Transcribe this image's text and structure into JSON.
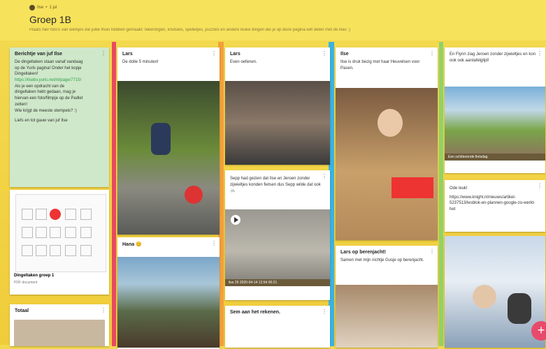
{
  "header": {
    "author": "Ilse",
    "breadcrumb_sep": "•",
    "time": "1 jul",
    "title": "Groep 1B",
    "subtitle": "Plaats hier foto's van werkjes die jullie thuis hebben gemaakt: tekeningen, knutsels, spelletjes, puzzels en andere leuke dingen die je op deze pagina wilt delen met de klas :)"
  },
  "cards": {
    "c1": {
      "title": "Berichtje van juf Ilse",
      "lines": [
        "De dingeltaken staan vanaf vandaag",
        "op de Yurls pagina! Onder het kopje",
        "Dingeltaken!",
        "https://ilsebv.yurls.net/nl/page/7715/",
        "Als je een opdracht van de",
        "dingeltaken hebt gedaan, mag je",
        "hiervan een foto/filmpje op de Padlet",
        "zetten!",
        "Wie krijgt de meeste stempels? :)",
        "",
        "Liefs en tot gauw van juf Ilse"
      ],
      "doc_title": "Dingeltaken groep 1",
      "doc_type": "PDF document"
    },
    "c2": {
      "title": "Lars",
      "text": "De dolle 5 minuten!"
    },
    "c3": {
      "title": "Hana",
      "emoji": "😊"
    },
    "c4": {
      "title": "Lars",
      "text": "Even oefenen."
    },
    "c5": {
      "text": "Sepp had gezien dat Ilse en Jeroen zonder zijwieltjes konden fietsen dus Sepp wilde dat ook 🚲",
      "video_caption": "ilse 29 2020-04-14 12:54",
      "video_duration": "00:21"
    },
    "c6": {
      "title": "Sem aan het rekenen."
    },
    "c7": {
      "title": "Ilse",
      "text": "Ilse is druk bezig met haar Heuvelsen voor Pasen."
    },
    "c8": {
      "title": "Lars op berenjacht!",
      "text": "Samen met mijn nichtje Gusje op berenjacht."
    },
    "c9": {
      "text": "En Flynn ziag Jeroen zonder zijwieltjes en kon ook ook aantafelglijd!",
      "img_caption": "Een schitterende fietsdag"
    },
    "c10": {
      "text": "Ode leuk!",
      "link": "https://www.knight.nl/nieuws/artikel-5237513/lesblok-en-plannen-google-zo-werkt-het"
    },
    "c11": {
      "title": "Totaal"
    }
  },
  "colors": {
    "header_bg": "#f7e25c",
    "wall_bg": "#f3d94e",
    "green_card": "#cfe8c9",
    "accent_pink": "#e74a6b"
  },
  "fab": {
    "label": "+"
  }
}
